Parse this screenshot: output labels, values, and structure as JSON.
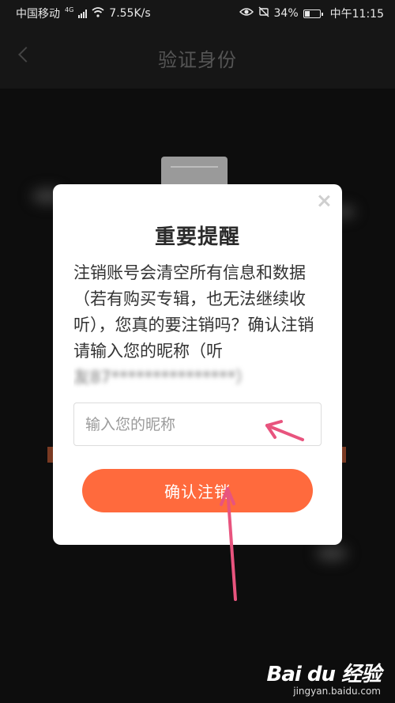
{
  "status_bar": {
    "carrier": "中国移动",
    "network": "4G",
    "speed": "7.55K/s",
    "battery": "34%",
    "time": "中午11:15"
  },
  "nav": {
    "title": "验证身份",
    "back_icon": "chevron-left-icon"
  },
  "dialog": {
    "title": "重要提醒",
    "message": "注销账号会清空所有信息和数据（若有购买专辑，也无法继续收听），您真的要注销吗？确认注销请输入您的昵称（听",
    "message_blurred": "友87***************）",
    "input_placeholder": "输入您的昵称",
    "input_value": "",
    "confirm_label": "确认注销",
    "close_icon": "close-icon"
  },
  "colors": {
    "accent": "#ff6a3d",
    "annotation_arrow": "#e8547e"
  },
  "watermark": {
    "logo": "Bai du 经验",
    "url": "jingyan.baidu.com"
  }
}
